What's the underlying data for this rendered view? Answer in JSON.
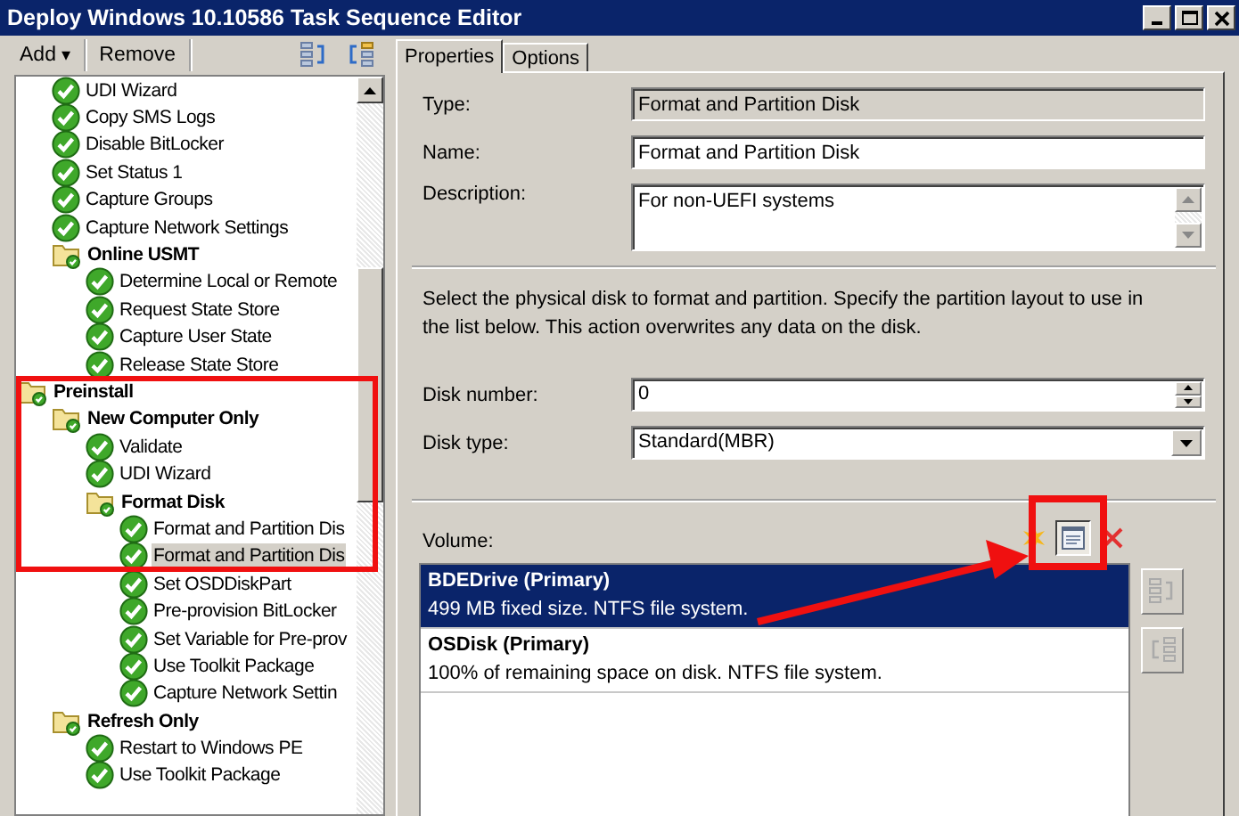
{
  "window": {
    "title": "Deploy Windows 10.10586 Task Sequence Editor"
  },
  "toolbar": {
    "add": "Add",
    "add_caret": "▾",
    "remove": "Remove"
  },
  "tree": [
    {
      "children": [
        {
          "label": "UDI Wizard",
          "kind": "step",
          "selected": false
        },
        {
          "label": "Copy SMS Logs",
          "kind": "step",
          "selected": false
        },
        {
          "label": "Disable BitLocker",
          "kind": "step",
          "selected": false
        },
        {
          "label": "Set Status 1",
          "kind": "step",
          "selected": false
        },
        {
          "label": "Capture Groups",
          "kind": "step",
          "selected": false
        },
        {
          "label": "Capture Network Settings",
          "kind": "step",
          "selected": false
        },
        {
          "label": "Online USMT",
          "kind": "group",
          "selected": false,
          "children": [
            {
              "label": "Determine Local or Remote",
              "kind": "step",
              "selected": false
            },
            {
              "label": "Request State Store",
              "kind": "step",
              "selected": false
            },
            {
              "label": "Capture User State",
              "kind": "step",
              "selected": false
            },
            {
              "label": "Release State Store",
              "kind": "step",
              "selected": false
            }
          ]
        }
      ]
    },
    {
      "label": "Preinstall",
      "kind": "group",
      "selected": false,
      "children": [
        {
          "label": "New Computer Only",
          "kind": "group",
          "selected": false,
          "children": [
            {
              "label": "Validate",
              "kind": "step",
              "selected": false
            },
            {
              "label": "UDI Wizard",
              "kind": "step",
              "selected": false
            },
            {
              "label": "Format Disk",
              "kind": "group",
              "selected": false,
              "children": [
                {
                  "label": "Format and Partition Dis",
                  "kind": "step",
                  "selected": false
                },
                {
                  "label": "Format and Partition Dis",
                  "kind": "step",
                  "selected": true
                },
                {
                  "label": "Set OSDDiskPart",
                  "kind": "step",
                  "selected": false
                },
                {
                  "label": "Pre-provision BitLocker",
                  "kind": "step",
                  "selected": false
                },
                {
                  "label": "Set Variable for Pre-prov",
                  "kind": "step",
                  "selected": false
                },
                {
                  "label": "Use Toolkit Package",
                  "kind": "step",
                  "selected": false
                },
                {
                  "label": "Capture Network Settin",
                  "kind": "step",
                  "selected": false
                }
              ]
            }
          ]
        },
        {
          "label": "Refresh Only",
          "kind": "group",
          "selected": false,
          "children": [
            {
              "label": "Restart to Windows PE",
              "kind": "step",
              "selected": false
            },
            {
              "label": "Use Toolkit Package",
              "kind": "step",
              "selected": false
            }
          ]
        }
      ]
    }
  ],
  "tabs": [
    {
      "label": "Properties",
      "selected": true
    },
    {
      "label": "Options",
      "selected": false
    }
  ],
  "fields": {
    "type_label": "Type:",
    "type_value": "Format and Partition Disk",
    "name_label": "Name:",
    "name_value": "Format and Partition Disk",
    "description_label": "Description:",
    "description_value": "For non-UEFI systems"
  },
  "instructions": "Select the physical disk to format and partition. Specify the partition layout to use in the list below. This action overwrites any data on the disk.",
  "disk_number": {
    "label": "Disk number:",
    "value": "0"
  },
  "disk_type": {
    "label": "Disk type:",
    "value": "Standard(MBR)"
  },
  "volume": {
    "label": "Volume:",
    "items": [
      {
        "title": "BDEDrive (Primary)",
        "detail": "499 MB fixed size. NTFS file system.",
        "selected": true
      },
      {
        "title": "OSDisk (Primary)",
        "detail": "100% of remaining space on disk. NTFS file system.",
        "selected": false
      }
    ]
  }
}
